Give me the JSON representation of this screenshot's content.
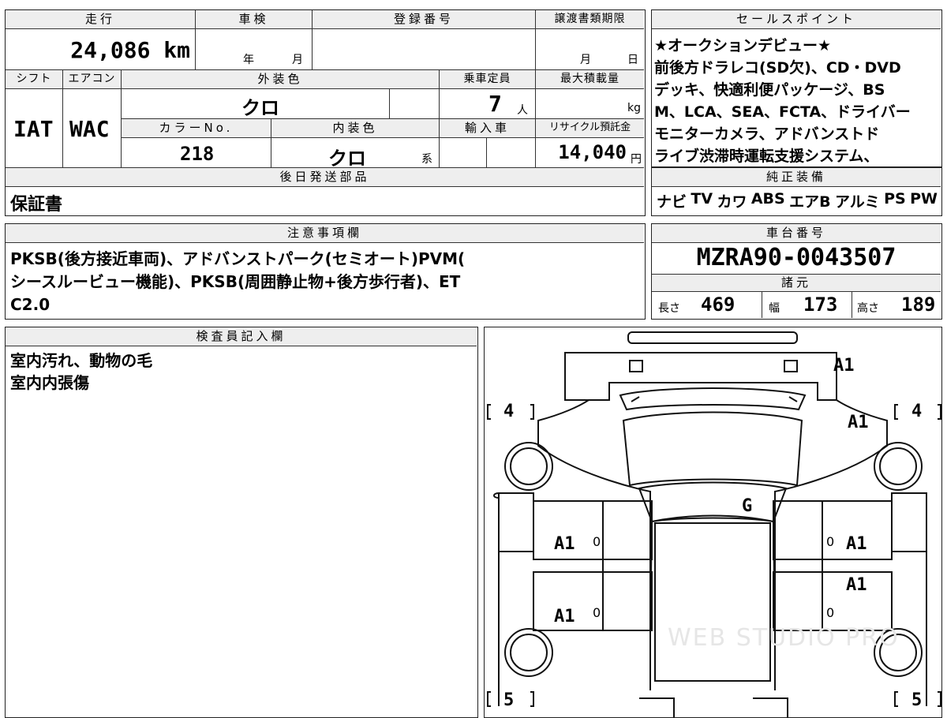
{
  "sheet": {
    "mileage_label": "走行",
    "mileage_value": "24,086 km",
    "shaken_label": "車検",
    "shaken_year": "年",
    "shaken_month": "月",
    "reg_label": "登録番号",
    "transfer_label": "譲渡書類期限",
    "transfer_month": "月",
    "transfer_day": "日",
    "shift_label": "シフト",
    "shift_value": "IAT",
    "ac_label": "エアコン",
    "ac_value": "WAC",
    "ext_color_label": "外装色",
    "ext_color_value": "クロ",
    "seats_label": "乗車定員",
    "seats_value": "7",
    "seats_unit": "人",
    "load_label": "最大積載量",
    "load_unit": "kg",
    "color_no_label": "カラーNo.",
    "color_no_value": "218",
    "int_color_label": "内装色",
    "int_color_value": "クロ",
    "int_color_suffix": "系",
    "import_label": "輸入車",
    "recycle_label": "リサイクル預託金",
    "recycle_value": "14,040",
    "recycle_unit": "円",
    "later_parts_label": "後日発送部品",
    "later_parts_value": "保証書"
  },
  "sales": {
    "label": "セールスポイント",
    "text": "★オークションデビュー★\n前後方ドラレコ(SD欠)、CD・DVD\nデッキ、快適利便パッケージ、BS\nM、LCA、SEA、FCTA、ドライバー\nモニターカメラ、アドバンストド\nライブ渋滞時運転支援システム、"
  },
  "equipment": {
    "label": "純正装備",
    "items": [
      "ナビ",
      "TV",
      "カワ",
      "ABS",
      "エアB",
      "アルミ",
      "PS",
      "PW"
    ]
  },
  "notes": {
    "label": "注意事項欄",
    "text": "PKSB(後方接近車両)、アドバンストパーク(セミオート)PVM(\nシースルービュー機能)、PKSB(周囲静止物+後方歩行者)、ET\nC2.0"
  },
  "chassis": {
    "label": "車台番号",
    "value": "MZRA90-0043507",
    "spec_label": "諸元",
    "length_label": "長さ",
    "length_value": "469",
    "width_label": "幅",
    "width_value": "173",
    "height_label": "高さ",
    "height_value": "189"
  },
  "inspector": {
    "label": "検査員記入欄",
    "text": "室内汚れ、動物の毛\n室内内張傷"
  },
  "diagram": {
    "tires": {
      "front_left": "4",
      "front_right": "4",
      "rear_left": "5",
      "rear_right": "5"
    },
    "marks": {
      "rear_top": "A1",
      "right_front_fender": "A1",
      "windshield": "G",
      "left_front_door": "A1",
      "right_front_door": "A1",
      "right_rear_door": "A1",
      "left_rear_door": "A1",
      "pillar_1": "0",
      "pillar_2": "0",
      "pillar_3": "0",
      "pillar_4": "0"
    },
    "watermark": "WEB STUDIO PRO"
  }
}
